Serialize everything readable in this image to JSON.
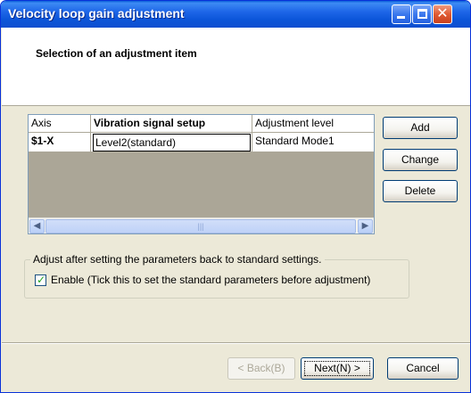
{
  "window": {
    "title": "Velocity loop gain adjustment"
  },
  "header": {
    "title": "Selection of an adjustment item"
  },
  "table": {
    "columns": [
      "Axis",
      "Vibration signal setup",
      "Adjustment level"
    ],
    "rows": [
      {
        "axis": "$1-X",
        "vibration": "Level2(standard)",
        "level": "Standard Mode1"
      }
    ]
  },
  "side_buttons": {
    "add": "Add",
    "change": "Change",
    "delete": "Delete"
  },
  "group": {
    "legend": "Adjust after setting the parameters back to standard settings.",
    "enable_label": "Enable (Tick this to set the standard parameters before adjustment)",
    "enable_checked": true
  },
  "footer": {
    "back": "< Back(B)",
    "next": "Next(N) >",
    "cancel": "Cancel"
  },
  "colors": {
    "titlebar": "#0c55d9",
    "dialog_bg": "#ece9d8",
    "grid_empty": "#aba697"
  }
}
